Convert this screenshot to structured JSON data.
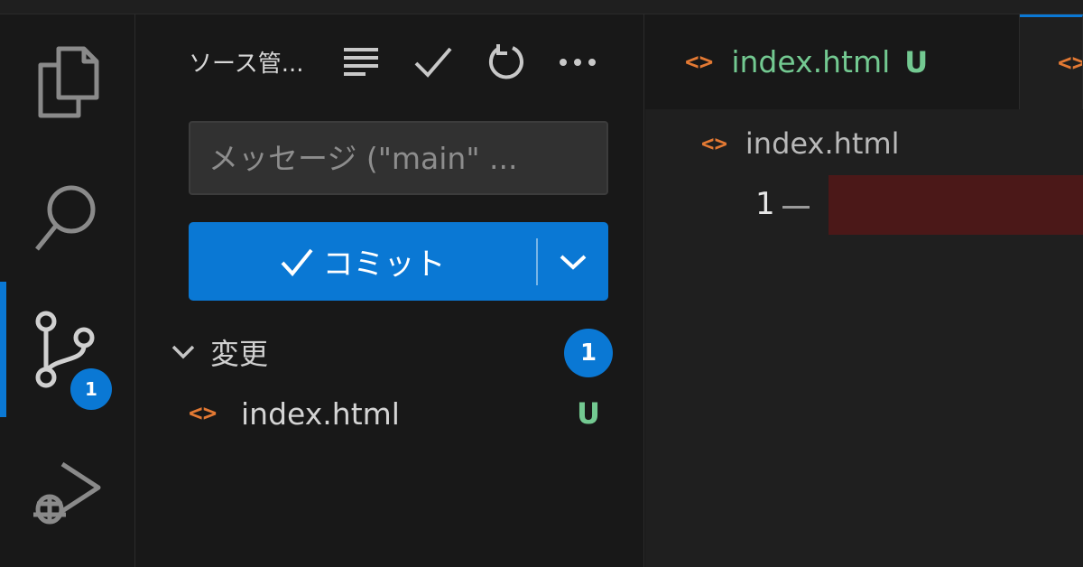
{
  "sidebar": {
    "title": "ソース管...",
    "message_placeholder": "メッセージ (\"main\" ...",
    "commit_label": "コミット",
    "changes": {
      "label": "変更",
      "count": "1",
      "files": [
        {
          "name": "index.html",
          "status": "U"
        }
      ]
    }
  },
  "activitybar": {
    "items": [
      "files-icon",
      "search-icon",
      "source-control-icon",
      "run-debug-icon"
    ],
    "scm_badge": "1"
  },
  "editor": {
    "tabs": [
      {
        "name": "index.html",
        "status": "U",
        "icon": "<>"
      },
      {
        "name": "",
        "status": "",
        "icon": "<>"
      }
    ],
    "breadcrumb": {
      "icon": "<>",
      "name": "index.html"
    },
    "line_number": "1"
  },
  "colors": {
    "accent": "#0a78d4",
    "html_icon": "#e37933",
    "untracked": "#73c991",
    "deleted_line_bg": "#4b1818"
  }
}
